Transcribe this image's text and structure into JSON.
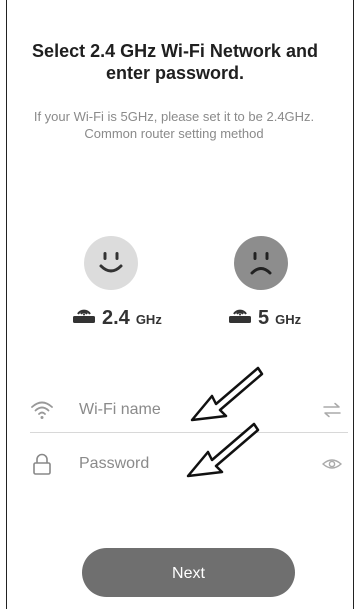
{
  "header": {
    "title": "Select 2.4 GHz Wi-Fi Network and enter password.",
    "subtitle": "If your Wi-Fi is 5GHz, please set it to be 2.4GHz. Common router setting method"
  },
  "bands": [
    {
      "value": "2.4",
      "unit": "GHz",
      "face_icon": "happy-face-icon",
      "router_icon": "router-icon"
    },
    {
      "value": "5",
      "unit": "GHz",
      "face_icon": "sad-face-icon",
      "router_icon": "router-icon"
    }
  ],
  "form": {
    "wifi": {
      "placeholder": "Wi-Fi name",
      "value": "",
      "icon": "wifi-icon",
      "action_icon": "switch-network-icon"
    },
    "password": {
      "placeholder": "Password",
      "value": "",
      "icon": "lock-icon",
      "action_icon": "eye-icon"
    }
  },
  "actions": {
    "next_label": "Next"
  },
  "colors": {
    "button": "#6f6f6f",
    "happy_face_bg": "#dcdcdc",
    "sad_face_bg": "#8d8d8d",
    "muted_text": "#8a8a8a"
  }
}
